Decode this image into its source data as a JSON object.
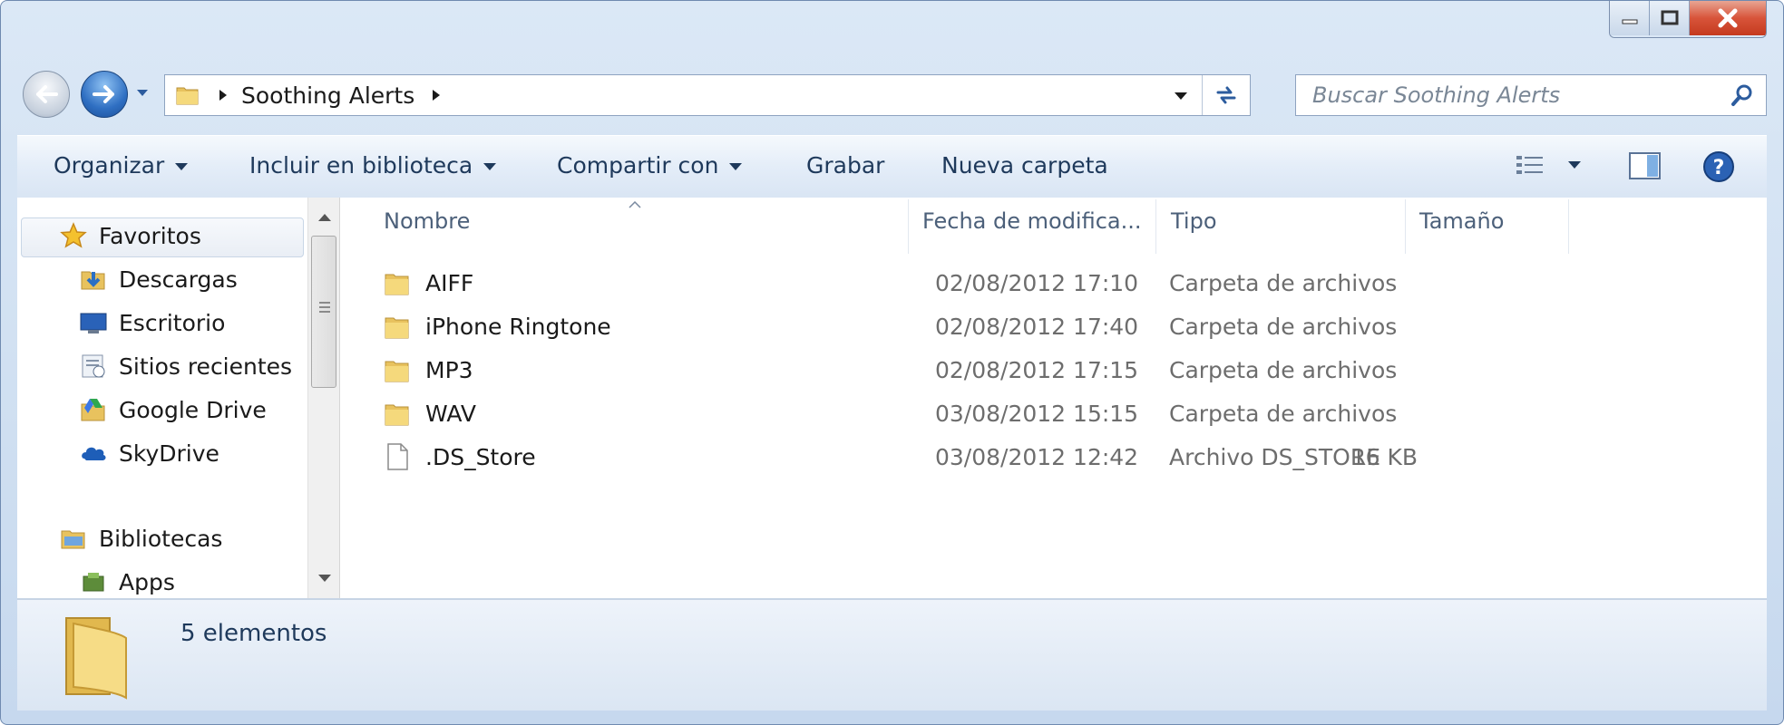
{
  "window": {
    "caption_buttons": [
      "minimize-icon",
      "maximize-icon",
      "close-icon"
    ]
  },
  "navigation": {
    "breadcrumb": "Soothing Alerts",
    "search_placeholder": "Buscar Soothing Alerts"
  },
  "toolbar": {
    "organize": "Organizar",
    "include_library": "Incluir en biblioteca",
    "share_with": "Compartir con",
    "burn": "Grabar",
    "new_folder": "Nueva carpeta"
  },
  "sidebar": {
    "favorites_label": "Favoritos",
    "items": [
      {
        "label": "Descargas",
        "icon": "downloads-icon"
      },
      {
        "label": "Escritorio",
        "icon": "desktop-icon"
      },
      {
        "label": "Sitios recientes",
        "icon": "recent-places-icon"
      },
      {
        "label": "Google Drive",
        "icon": "google-drive-icon"
      },
      {
        "label": "SkyDrive",
        "icon": "skydrive-icon"
      }
    ],
    "libraries_label": "Bibliotecas",
    "libraries": [
      {
        "label": "Apps",
        "icon": "apps-library-icon"
      }
    ]
  },
  "columns": {
    "name": "Nombre",
    "date": "Fecha de modifica...",
    "type": "Tipo",
    "size": "Tamaño"
  },
  "files": [
    {
      "name": "AIFF",
      "date": "02/08/2012 17:10",
      "type": "Carpeta de archivos",
      "size": "",
      "kind": "folder"
    },
    {
      "name": "iPhone Ringtone",
      "date": "02/08/2012 17:40",
      "type": "Carpeta de archivos",
      "size": "",
      "kind": "folder"
    },
    {
      "name": "MP3",
      "date": "02/08/2012 17:15",
      "type": "Carpeta de archivos",
      "size": "",
      "kind": "folder"
    },
    {
      "name": "WAV",
      "date": "03/08/2012 15:15",
      "type": "Carpeta de archivos",
      "size": "",
      "kind": "folder"
    },
    {
      "name": ".DS_Store",
      "date": "03/08/2012 12:42",
      "type": "Archivo DS_STORE",
      "size": "16 KB",
      "kind": "file"
    }
  ],
  "details": {
    "count": "5 elementos"
  }
}
